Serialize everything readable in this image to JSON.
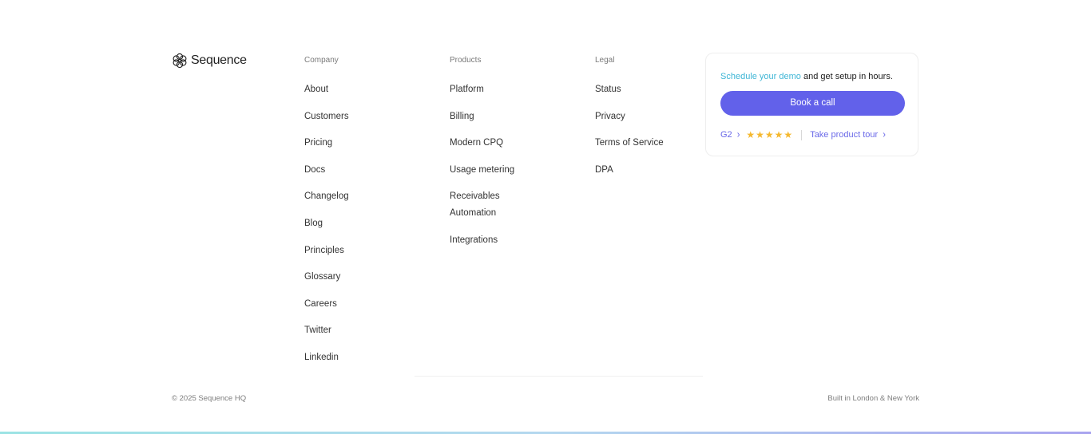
{
  "brand": {
    "name": "Sequence",
    "logo_icon": "flower-hex-icon"
  },
  "columns": {
    "company": {
      "heading": "Company",
      "items": [
        "About",
        "Customers",
        "Pricing",
        "Docs",
        "Changelog",
        "Blog",
        "Principles",
        "Glossary",
        "Careers",
        "Twitter",
        "Linkedin"
      ]
    },
    "products": {
      "heading": "Products",
      "items": [
        "Platform",
        "Billing",
        "Modern CPQ",
        "Usage metering",
        "Receivables Automation",
        "Integrations"
      ]
    },
    "legal": {
      "heading": "Legal",
      "items": [
        "Status",
        "Privacy",
        "Terms of Service",
        "DPA"
      ]
    }
  },
  "cta": {
    "link_text": "Schedule your demo",
    "rest_text": " and get setup in hours.",
    "button_label": "Book a call",
    "g2_label": "G2",
    "rating_stars": 5,
    "tour_label": "Take product tour"
  },
  "footer": {
    "copyright": "© 2025 Sequence HQ",
    "built_in": "Built in London & New York"
  },
  "colors": {
    "accent": "#6261ea",
    "link_teal": "#3fb6d6",
    "star": "#f5b82e"
  }
}
